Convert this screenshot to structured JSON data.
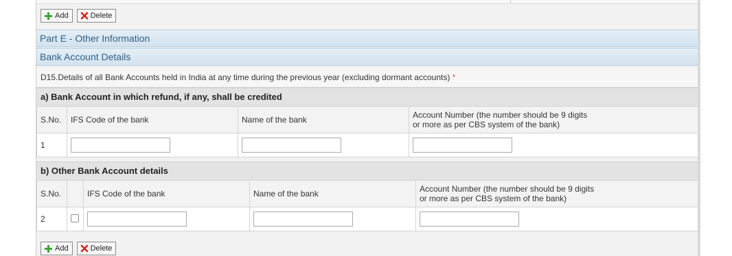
{
  "toolbar_top": {
    "add_label": "Add",
    "delete_label": "Delete"
  },
  "part_e_title": "Part E - Other Information",
  "bank_section_title": "Bank Account Details",
  "d15": {
    "text": "D15.Details of all Bank Accounts held in India at any time during the previous year (excluding dormant accounts)",
    "required_mark": "*"
  },
  "refund_account": {
    "heading": "a) Bank Account in which refund, if any, shall be credited",
    "columns": {
      "sno": "S.No.",
      "ifsc": "IFS Code of the bank",
      "bank_name": "Name of the bank",
      "account_line1": "Account Number (the number should be 9 digits",
      "account_line2": "or more as per CBS system of the bank)"
    },
    "rows": [
      {
        "sno": "1",
        "ifsc": "",
        "bank_name": "",
        "account_number": ""
      }
    ]
  },
  "other_accounts": {
    "heading": "b) Other Bank Account details",
    "columns": {
      "sno": "S.No.",
      "ifsc": "IFS Code of the bank",
      "bank_name": "Name of the bank",
      "account_line1": "Account Number (the number should be 9 digits",
      "account_line2": "or more as per CBS system of the bank)"
    },
    "rows": [
      {
        "sno": "2",
        "selected": false,
        "ifsc": "",
        "bank_name": "",
        "account_number": ""
      }
    ]
  },
  "toolbar_bottom": {
    "add_label": "Add",
    "delete_label": "Delete"
  },
  "colors": {
    "section_text": "#2f5f86",
    "add_icon": "#3fa535",
    "delete_icon": "#d9231e",
    "required": "#d9534f"
  }
}
